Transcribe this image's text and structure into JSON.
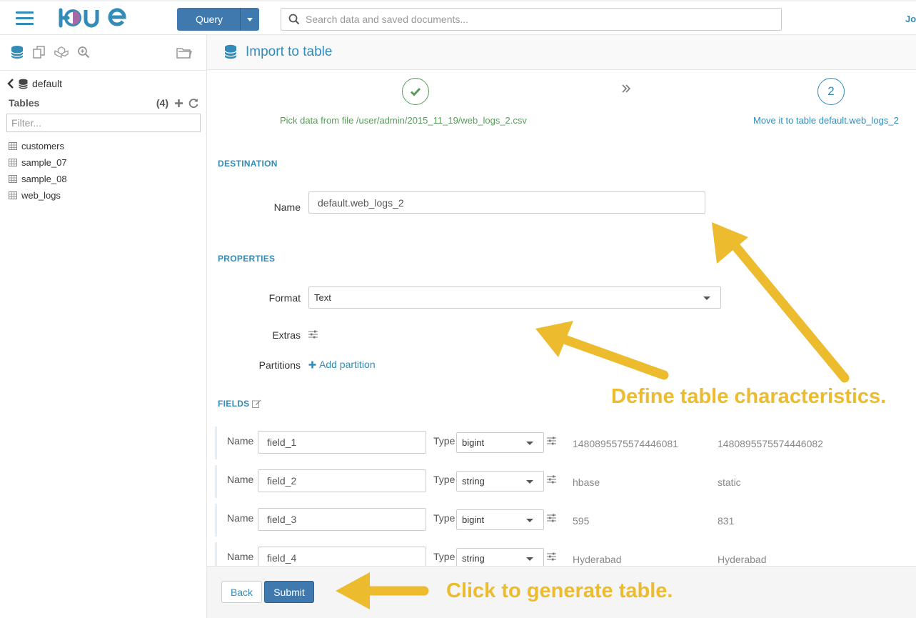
{
  "header": {
    "query_label": "Query",
    "search_placeholder": "Search data and saved documents...",
    "user": "Jo"
  },
  "sidebar": {
    "database": "default",
    "tables_label": "Tables",
    "tables_count": "(4)",
    "filter_placeholder": "Filter...",
    "tables": [
      "customers",
      "sample_07",
      "sample_08",
      "web_logs"
    ]
  },
  "page": {
    "title": "Import to table",
    "step2_number": "2",
    "step1_label": "Pick data from file /user/admin/2015_11_19/web_logs_2.csv",
    "step2_label": "Move it to table default.web_logs_2"
  },
  "destination": {
    "heading": "DESTINATION",
    "name_label": "Name",
    "name_value": "default.web_logs_2"
  },
  "properties": {
    "heading": "PROPERTIES",
    "format_label": "Format",
    "format_value": "Text",
    "extras_label": "Extras",
    "partitions_label": "Partitions",
    "add_partition": "Add partition"
  },
  "fields": {
    "heading": "FIELDS",
    "name_label": "Name",
    "type_label": "Type",
    "rows": [
      {
        "name": "field_1",
        "type": "bigint",
        "sample1": "1480895575574446081",
        "sample2": "1480895575574446082"
      },
      {
        "name": "field_2",
        "type": "string",
        "sample1": "hbase",
        "sample2": "static"
      },
      {
        "name": "field_3",
        "type": "bigint",
        "sample1": "595",
        "sample2": "831"
      },
      {
        "name": "field_4",
        "type": "string",
        "sample1": "Hyderabad",
        "sample2": "Hyderabad"
      }
    ]
  },
  "footer": {
    "back_label": "Back",
    "submit_label": "Submit"
  },
  "annotations": {
    "define": "Define table characteristics.",
    "click": "Click to generate table."
  },
  "colors": {
    "accent": "#338bb8",
    "primary_button": "#3f79ad",
    "success": "#5a9a5a",
    "annotation": "#ecbb2e"
  }
}
